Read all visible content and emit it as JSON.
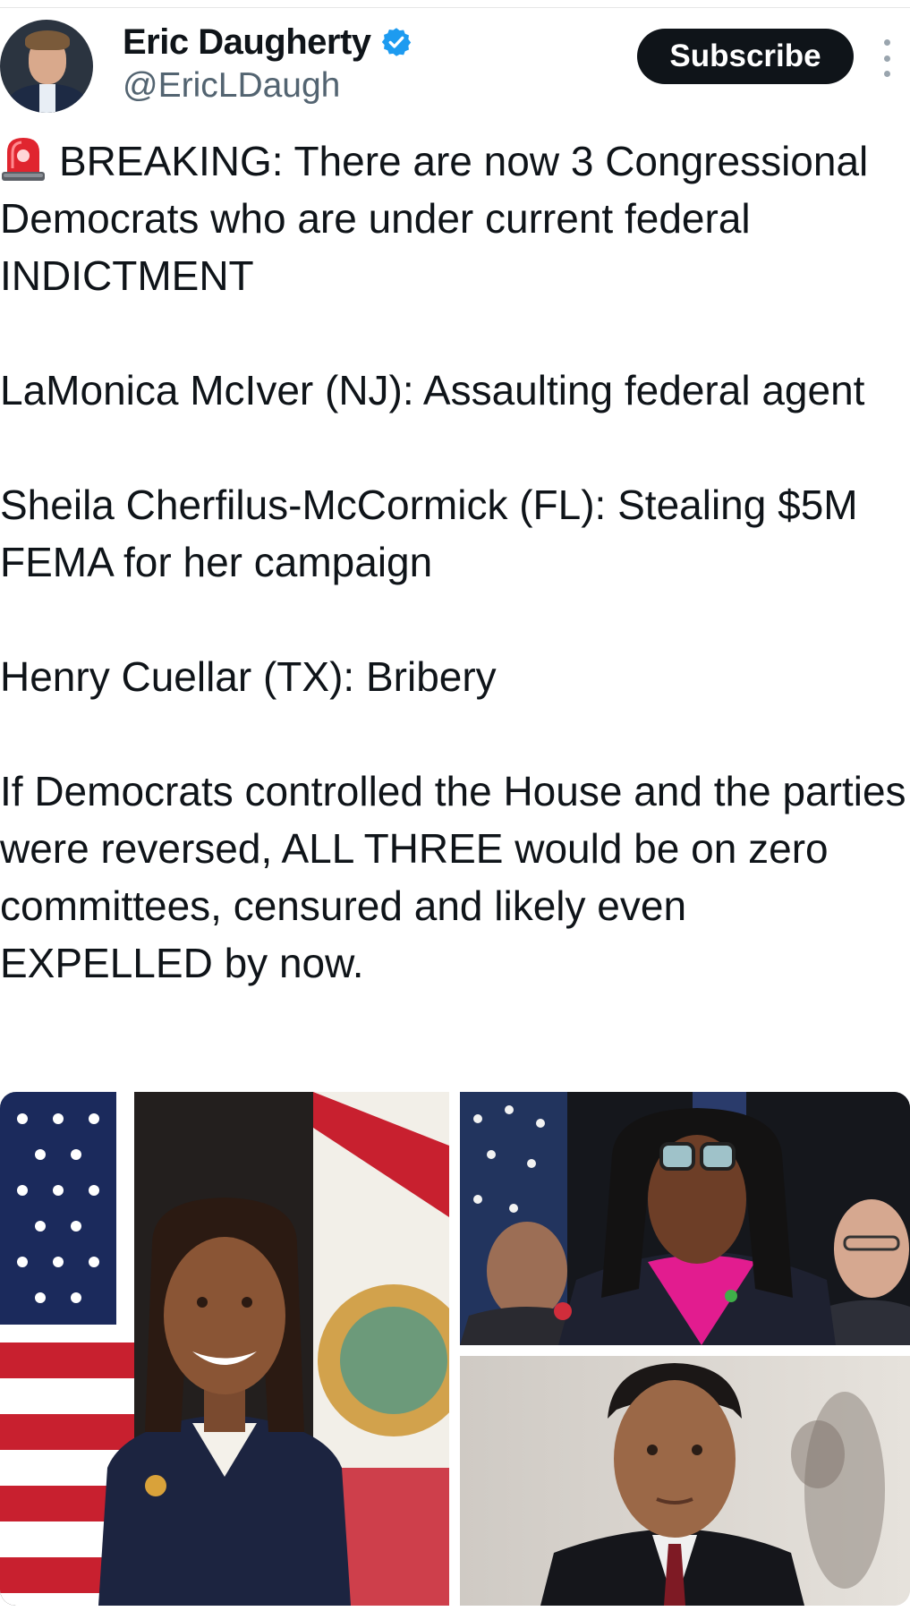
{
  "post": {
    "author_name": "Eric Daugherty",
    "author_handle": "@EricLDaugh",
    "verified": true,
    "subscribe_label": "Subscribe",
    "icons": {
      "avatar": "profile-photo",
      "verified": "verified-badge-icon",
      "more": "more-options-icon",
      "siren": "police-light-emoji"
    },
    "paragraphs": {
      "p1": "BREAKING: There are now 3 Congressional Democrats who are under current federal INDICTMENT",
      "p2": "LaMonica McIver (NJ): Assaulting federal agent",
      "p3": "Sheila Cherfilus-McCormick (FL): Stealing $5M FEMA for her campaign",
      "p4": "Henry Cuellar (TX): Bribery",
      "p5": "If Democrats controlled the House and the parties were reversed, ALL THREE would be on zero committees, censured and likely even EXPELLED by now."
    },
    "colors": {
      "verified_blue": "#1d9bf0",
      "subscribe_bg": "#0f1419",
      "handle_gray": "#536471"
    }
  }
}
